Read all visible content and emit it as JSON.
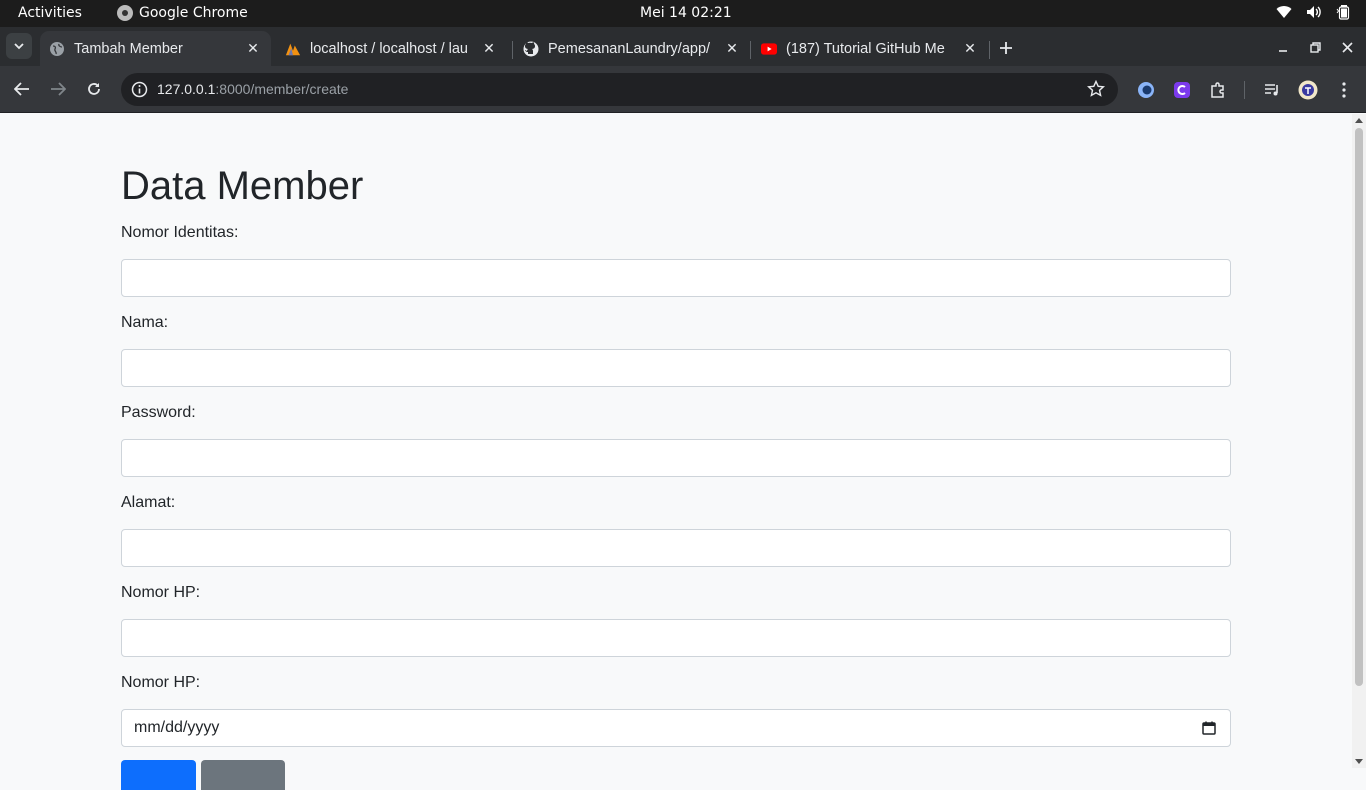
{
  "system_bar": {
    "activities": "Activities",
    "app_name": "Google Chrome",
    "clock": "Mei 14  02:21"
  },
  "tabs": [
    {
      "title": "Tambah Member",
      "favicon": "globe-icon",
      "active": true
    },
    {
      "title": "localhost / localhost / lau",
      "favicon": "phpmyadmin-icon",
      "active": false
    },
    {
      "title": "PemesananLaundry/app/",
      "favicon": "github-icon",
      "active": false
    },
    {
      "title": "(187) Tutorial GitHub Me",
      "favicon": "youtube-icon",
      "active": false
    }
  ],
  "address_bar": {
    "host": "127.0.0.1",
    "path": ":8000/member/create"
  },
  "form": {
    "heading": "Data Member",
    "fields": [
      {
        "label": "Nomor Identitas:",
        "value": ""
      },
      {
        "label": "Nama:",
        "value": ""
      },
      {
        "label": "Password:",
        "value": ""
      },
      {
        "label": "Alamat:",
        "value": ""
      },
      {
        "label": "Nomor HP:",
        "value": ""
      },
      {
        "label": "Nomor HP:",
        "value": "",
        "placeholder": "mm/dd/yyyy"
      }
    ]
  },
  "colors": {
    "primary": "#0d6efd",
    "secondary": "#6c757d",
    "page_bg": "#f8f9fa"
  }
}
